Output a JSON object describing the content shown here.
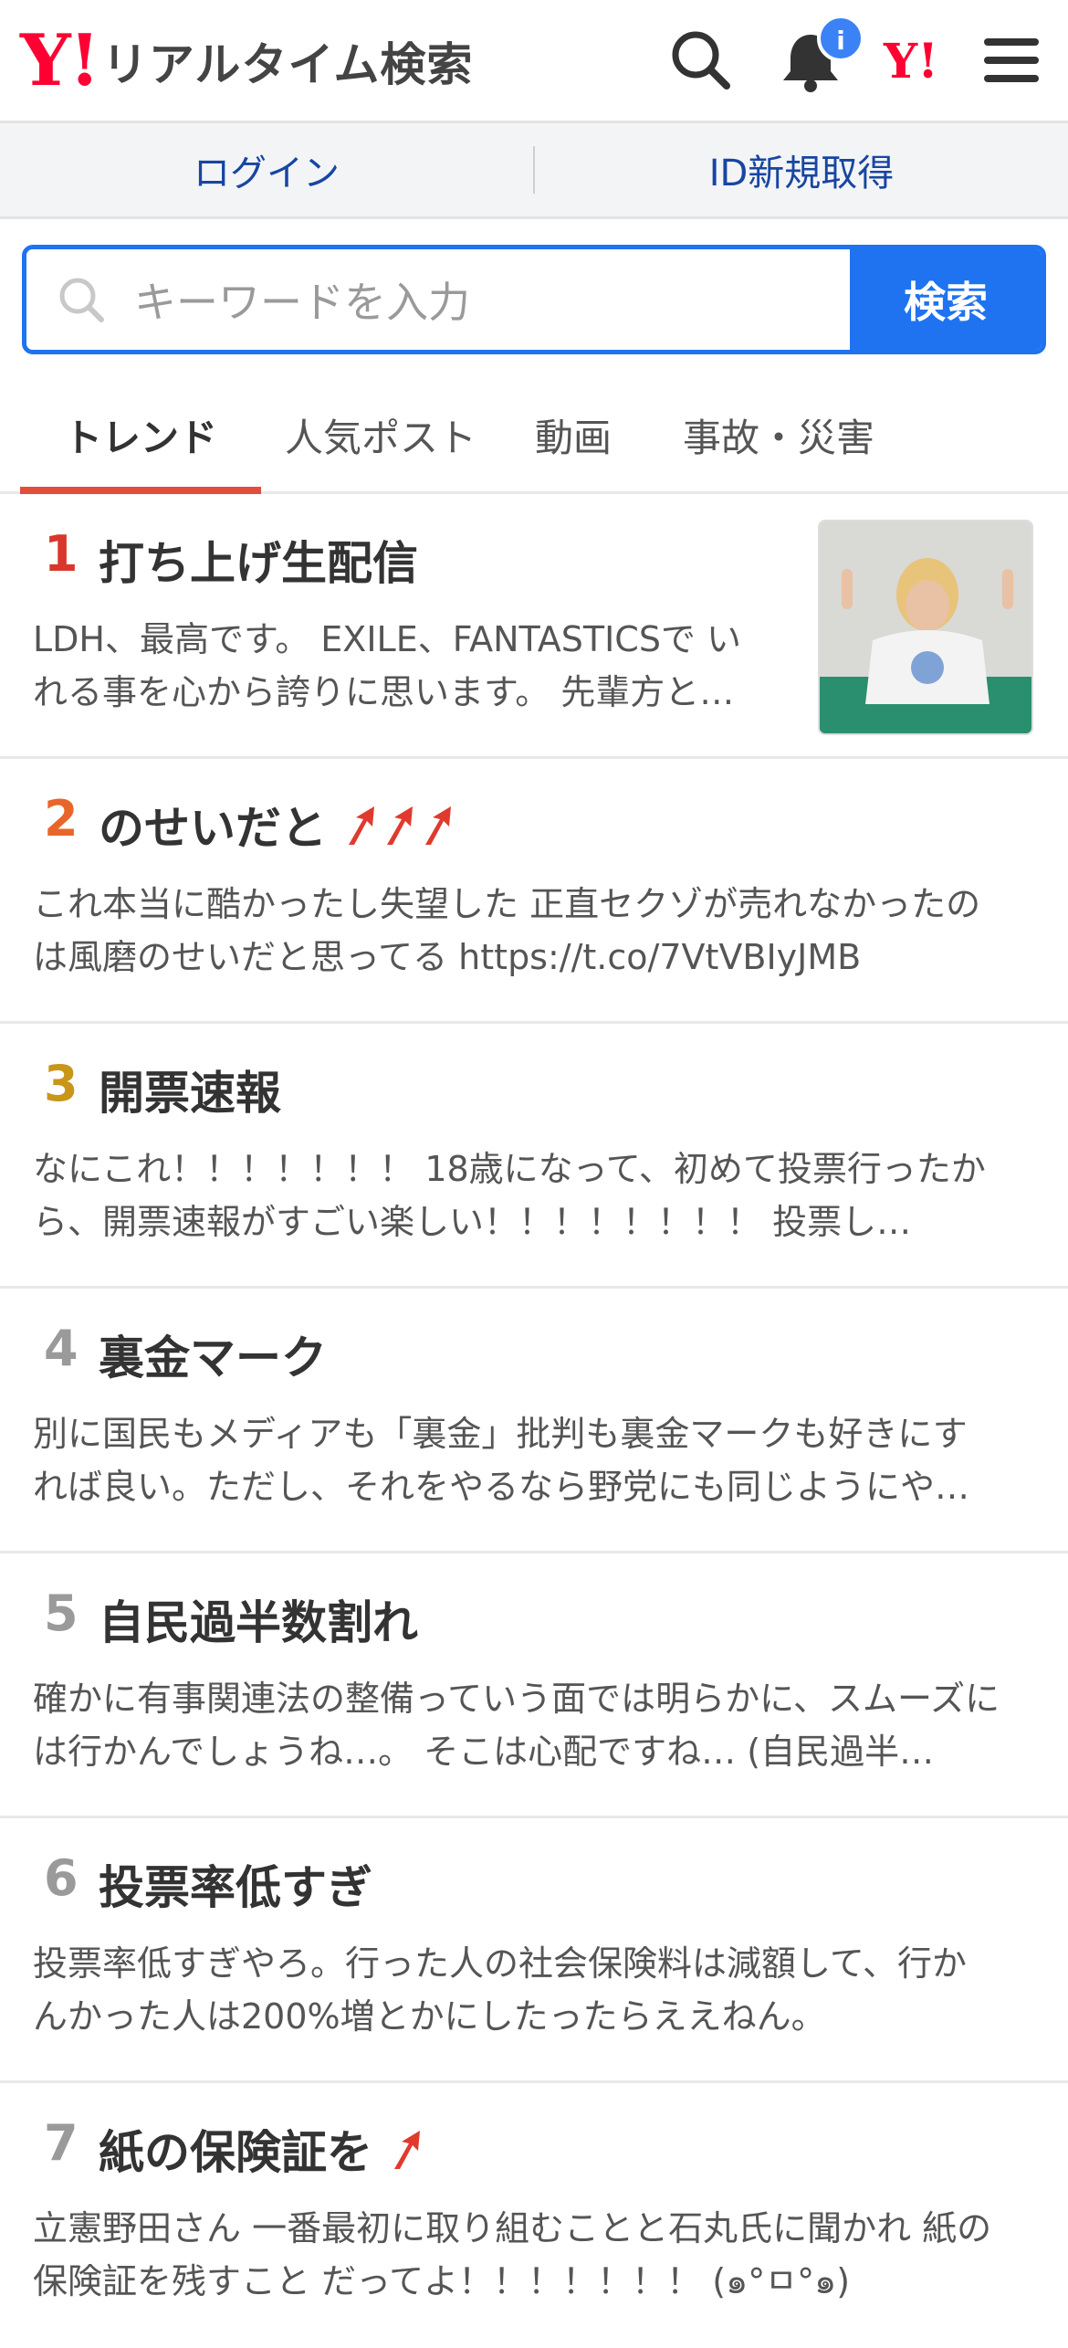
{
  "header": {
    "logo_mark": "Y!",
    "logo_text": "リアルタイム検索",
    "notification_count": "i",
    "yahoo_mark": "Y!"
  },
  "auth": {
    "login": "ログイン",
    "signup": "ID新規取得"
  },
  "search": {
    "placeholder": "キーワードを入力",
    "button": "検索"
  },
  "tabs": [
    {
      "label": "トレンド",
      "active": true
    },
    {
      "label": "人気ポスト",
      "active": false
    },
    {
      "label": "動画",
      "active": false
    },
    {
      "label": "事故・災害",
      "active": false
    }
  ],
  "colors": {
    "accent": "#1f73f0",
    "brand": "#ff0033",
    "tab_underline": "#e24d3c",
    "rank1": "#d9372b",
    "rank2": "#e8662a",
    "rank3": "#c9961a",
    "rank_other": "#9a9a9a"
  },
  "trends": [
    {
      "rank": "1",
      "title": "打ち上げ生配信",
      "desc": "LDH、最高です。 EXILE、FANTASTICSで いれる事を心から誇りに思います。 先輩方と…",
      "arrows": 0,
      "has_thumb": true
    },
    {
      "rank": "2",
      "title": "のせいだと",
      "desc": "これ本当に酷かったし失望した 正直セクゾが売れなかったのは風磨のせいだと思ってる https://t.co/7VtVBIyJMB",
      "arrows": 3
    },
    {
      "rank": "3",
      "title": "開票速報",
      "desc": "なにこれ！！！！！！！ 18歳になって、初めて投票行ったから、開票速報がすごい楽しい！！！！！！！！ 投票し…",
      "arrows": 0
    },
    {
      "rank": "4",
      "title": "裏金マーク",
      "desc": "別に国民もメディアも「裏金」批判も裏金マークも好きにすれば良い。ただし、それをやるなら野党にも同じようにや…",
      "arrows": 0
    },
    {
      "rank": "5",
      "title": "自民過半数割れ",
      "desc": "確かに有事関連法の整備っていう面では明らかに、スムーズには行かんでしょうね…。 そこは心配ですね… (自民過半…",
      "arrows": 0
    },
    {
      "rank": "6",
      "title": "投票率低すぎ",
      "desc": "投票率低すぎやろ。行った人の社会保険料は減額して、行かんかった人は200%増とかにしたったらええねん。",
      "arrows": 0
    },
    {
      "rank": "7",
      "title": "紙の保険証を",
      "desc": "立憲野田さん 一番最初に取り組むことと石丸氏に聞かれ 紙の保険証を残すこと だってよ！！！！！！！ (๑°ㅁ°๑)",
      "arrows": 1
    }
  ]
}
